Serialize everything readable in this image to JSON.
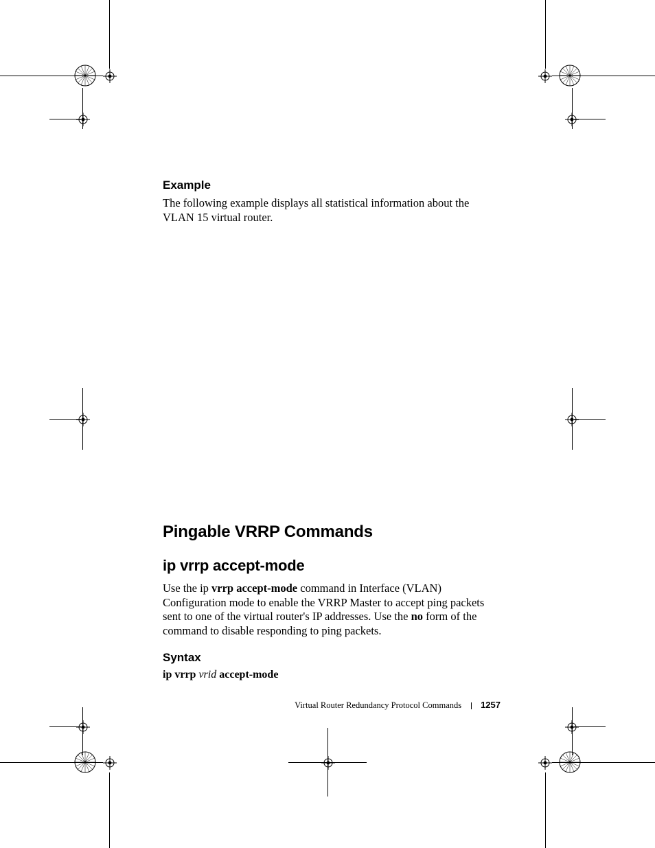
{
  "section_example": {
    "heading": "Example",
    "paragraph": "The following example displays all statistical information about the VLAN 15 virtual router."
  },
  "section_pingable": {
    "heading": "Pingable VRRP Commands"
  },
  "section_accept_mode": {
    "heading": "ip vrrp accept-mode",
    "desc_pre": "Use the ip ",
    "desc_cmd": "vrrp accept-mode",
    "desc_mid": " command in Interface (VLAN) Configuration mode to enable the VRRP Master to accept ping packets sent to one of the virtual router's IP addresses. Use the ",
    "desc_no": "no",
    "desc_post": " form of the command to disable responding to ping packets."
  },
  "syntax": {
    "heading": "Syntax",
    "part1": "ip vrrp ",
    "vrid": "vrid",
    "part2": " accept-mode"
  },
  "footer": {
    "chapter": "Virtual Router Redundancy Protocol Commands",
    "page": "1257"
  }
}
